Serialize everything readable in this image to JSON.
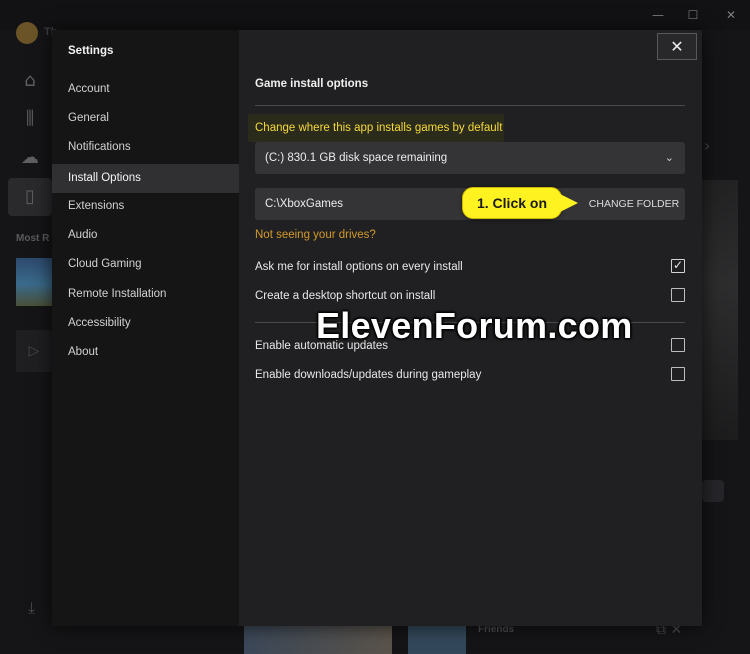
{
  "background_app": {
    "profile_name": "Th",
    "most_recent_label": "Most R",
    "friends_label": "Friends",
    "window_controls": [
      "—",
      "☐",
      "✕"
    ]
  },
  "settings": {
    "title": "Settings",
    "nav_items": [
      {
        "label": "Account"
      },
      {
        "label": "General"
      },
      {
        "label": "Notifications"
      },
      {
        "label": "Install Options",
        "active": true
      },
      {
        "label": "Extensions"
      },
      {
        "label": "Audio"
      },
      {
        "label": "Cloud Gaming"
      },
      {
        "label": "Remote Installation"
      },
      {
        "label": "Accessibility"
      },
      {
        "label": "About"
      }
    ],
    "close_icon": "✕"
  },
  "install_options": {
    "heading": "Game install options",
    "subheading": "Change where this app installs games by default",
    "drive_select_value": "(C:) 830.1 GB disk space remaining",
    "drive_select_chevron": "⌄",
    "folder_path": "C:\\XboxGames",
    "change_folder_label": "CHANGE FOLDER",
    "drives_link": "Not seeing your drives?",
    "options": [
      {
        "label": "Ask me for install options on every install",
        "checked": true
      },
      {
        "label": "Create a desktop shortcut on install",
        "checked": false
      },
      {
        "label": "Enable automatic updates",
        "checked": false
      },
      {
        "label": "Enable downloads/updates during gameplay",
        "checked": false
      }
    ]
  },
  "annotation": {
    "callout_text": "1. Click on",
    "callout_color": "#fff221"
  },
  "watermark": "ElevenForum.com",
  "colors": {
    "accent_subheading": "#f5d93b",
    "link": "#d39a2a",
    "nav_active_bg": "#303033"
  }
}
